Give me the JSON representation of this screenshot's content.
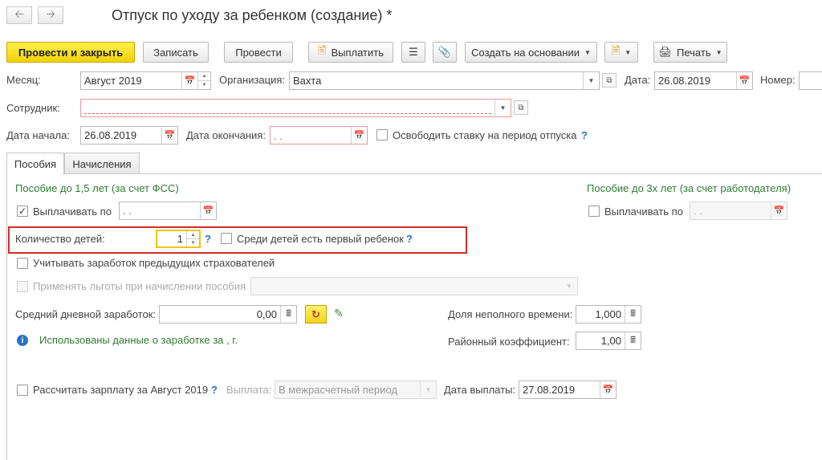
{
  "window": {
    "title": "Отпуск по уходу за ребенком (создание) *"
  },
  "toolbar": {
    "post_close": "Провести и закрыть",
    "save": "Записать",
    "post": "Провести",
    "pay": "Выплатить",
    "create_based_on": "Создать на основании",
    "print": "Печать"
  },
  "header": {
    "month_label": "Месяц:",
    "month_value": "Август 2019",
    "org_label": "Организация:",
    "org_value": "Вахта",
    "date_label": "Дата:",
    "date_value": "26.08.2019",
    "number_label": "Номер:",
    "number_value": "",
    "employee_label": "Сотрудник:",
    "employee_value": "",
    "start_label": "Дата начала:",
    "start_value": "26.08.2019",
    "end_label": "Дата окончания:",
    "end_value": ".  .",
    "free_rate_label": "Освободить ставку на период отпуска",
    "help": "?"
  },
  "tabs": [
    {
      "label": "Пособия",
      "active": true
    },
    {
      "label": "Начисления",
      "active": false
    }
  ],
  "benefits": {
    "fss_title": "Пособие до 1,5 лет (за счет ФСС)",
    "employer_title": "Пособие до 3х лет (за счет работодателя)",
    "pay_until_label": "Выплачивать по",
    "pay_until_value": ".  .",
    "pay_until_checked": true,
    "pay_until3_label": "Выплачивать по",
    "pay_until3_value": ".  .",
    "children_count_label": "Количество детей:",
    "children_count_value": "1",
    "first_child_label": "Среди детей есть первый ребенок",
    "prev_insurers_label": "Учитывать заработок предыдущих страхователей",
    "privileges_label": "Применять льготы при начислении пособия",
    "privileges_value": "",
    "avg_earnings_label": "Средний дневной заработок:",
    "avg_earnings_value": "0,00",
    "part_time_label": "Доля неполного времени:",
    "part_time_value": "1,000",
    "district_coef_label": "Районный коэффициент:",
    "district_coef_value": "1,00",
    "used_data_text": "Использованы данные о заработке за  ,   г."
  },
  "payroll": {
    "calc_label": "Рассчитать зарплату за Август 2019",
    "payout_label": "Выплата:",
    "payout_value": "В межрасчетный период",
    "pay_date_label": "Дата выплаты:",
    "pay_date_value": "27.08.2019"
  },
  "icons": {
    "back": "arrow-left",
    "forward": "arrow-right",
    "calendar": "calendar",
    "dropdown": "chevron-down"
  },
  "colors": {
    "primary_button": "#f0d20a",
    "section_title": "#2f7d32",
    "highlight_frame": "#d42b2b",
    "help": "#2a73c5"
  }
}
